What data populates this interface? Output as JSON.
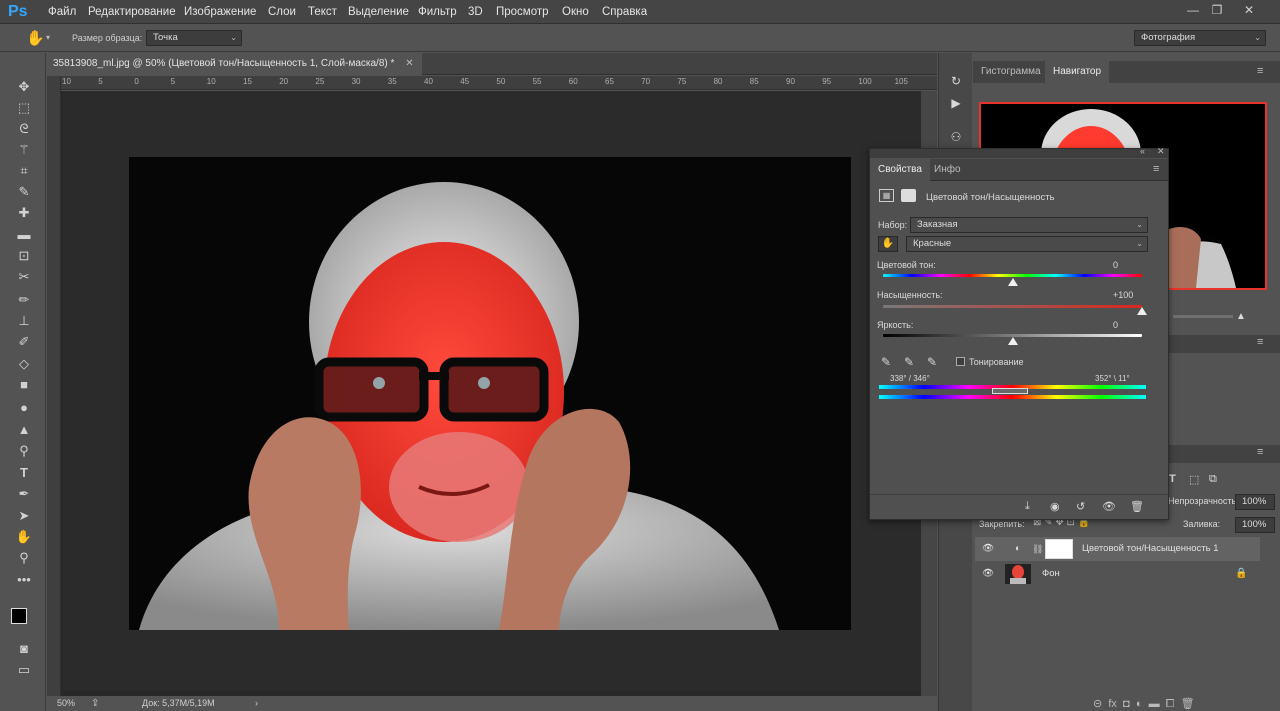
{
  "app": {
    "logo": "Ps"
  },
  "menu": [
    "Файл",
    "Редактирование",
    "Изображение",
    "Слои",
    "Текст",
    "Выделение",
    "Фильтр",
    "3D",
    "Просмотр",
    "Окно",
    "Справка"
  ],
  "window_controls": {
    "minimize": "—",
    "restore": "❐",
    "close": "✕"
  },
  "options": {
    "sample_size_label": "Размер образца:",
    "sample_size_value": "Точка",
    "workspace": "Фотография"
  },
  "document": {
    "tab_title": "35813908_ml.jpg @ 50% (Цветовой тон/Насыщенность 1, Слой-маска/8) *",
    "close": "✕"
  },
  "ruler_ticks": [
    "10",
    "5",
    "0",
    "5",
    "10",
    "15",
    "20",
    "25",
    "30",
    "35",
    "40",
    "45",
    "50",
    "55",
    "60",
    "65",
    "70",
    "75",
    "80",
    "85",
    "90",
    "95",
    "100",
    "105"
  ],
  "status": {
    "zoom": "50%",
    "doc": "Док: 5,37M/5,19M",
    "arrow": "›"
  },
  "right_panel": {
    "tabs": [
      "Гистограмма",
      "Навигатор"
    ]
  },
  "properties": {
    "tabs": [
      "Свойства",
      "Инфо"
    ],
    "title": "Цветовой тон/Насыщенность",
    "preset_label": "Набор:",
    "preset_value": "Заказная",
    "channel_value": "Красные",
    "hue_label": "Цветовой тон:",
    "hue_value": "0",
    "sat_label": "Насыщенность:",
    "sat_value": "+100",
    "light_label": "Яркость:",
    "light_value": "0",
    "colorize_label": "Тонирование",
    "range_left": "338° / 346°",
    "range_right": "352° \\ 11°",
    "hue": 0,
    "saturation": 100,
    "lightness": 0
  },
  "layers": {
    "opacity_label": "Непрозрачность:",
    "opacity_value": "100%",
    "lock_label": "Закрепить:",
    "fill_label": "Заливка:",
    "fill_value": "100%",
    "items": [
      {
        "name": "Цветовой тон/Насыщенность 1"
      },
      {
        "name": "Фон"
      }
    ]
  },
  "colors": {
    "accent": "#31a8ff",
    "nav_frame": "#e8332a",
    "skin_red": "#ff3a2e"
  }
}
